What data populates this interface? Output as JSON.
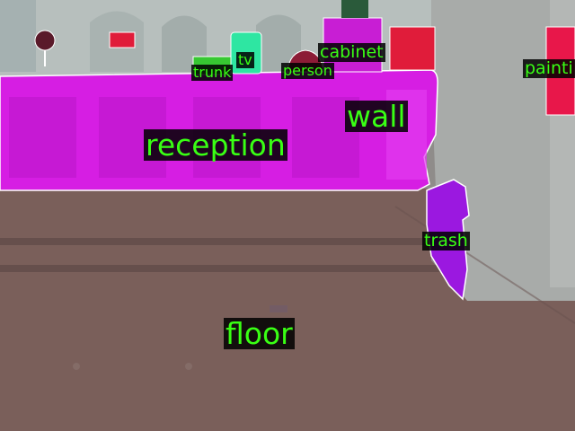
{
  "image": {
    "kind": "semantic-segmentation-overlay",
    "colors": {
      "floor": "#7a5f5a",
      "wall": "#d61ee3",
      "reception": "#d61ee3",
      "cabinet": "#c81ed4",
      "trash": "#9b18e0",
      "tv": "#2ee6a2",
      "trunk": "#37c832",
      "person": "#8c1c36",
      "painting": "#e8174a",
      "red_box": "#e01c3a",
      "background_wall": "#9da29f",
      "label_bg": "#000000",
      "label_text": "#39ff14"
    }
  },
  "labels": {
    "cabinet": "cabinet",
    "tv": "tv",
    "trunk": "trunk",
    "person": "person",
    "painting": "painti",
    "wall": "wall",
    "reception": "reception",
    "trash": "trash",
    "floor": "floor"
  }
}
